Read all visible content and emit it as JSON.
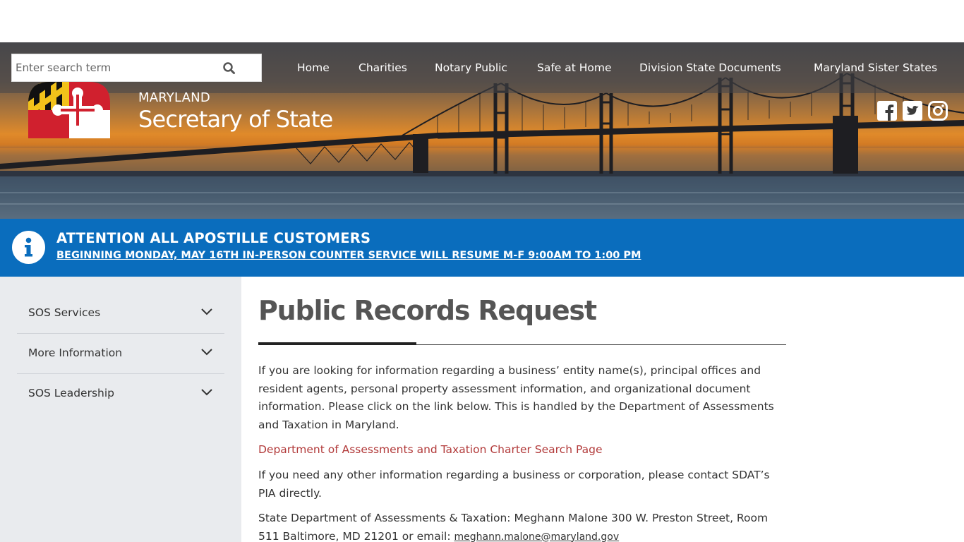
{
  "search": {
    "placeholder": "Enter search term",
    "icon": "search-icon"
  },
  "nav": {
    "items": [
      {
        "label": "Home"
      },
      {
        "label": "Charities"
      },
      {
        "label": "Notary Public"
      },
      {
        "label": "Safe at Home"
      },
      {
        "label": "Division State Documents"
      },
      {
        "label": "Maryland Sister States"
      }
    ]
  },
  "branding": {
    "kicker": "MARYLAND",
    "title": "Secretary of State"
  },
  "social": {
    "icons": [
      "facebook-icon",
      "twitter-icon",
      "instagram-icon"
    ]
  },
  "alert": {
    "title": "ATTENTION ALL APOSTILLE CUSTOMERS",
    "link": "BEGINNING MONDAY, MAY 16TH IN-PERSON COUNTER SERVICE WILL RESUME M-F 9:00AM TO 1:00 PM",
    "icon": "info-icon"
  },
  "sidebar": {
    "items": [
      {
        "label": "SOS Services"
      },
      {
        "label": "More Information"
      },
      {
        "label": "SOS Leadership"
      }
    ]
  },
  "main": {
    "title": "Public Records Request",
    "intro": "If you are looking for information regarding a business’ entity name(s), principal offices and resident agents, personal property assessment information, and organizational document information. Please click on the link below. This is handled by the Department of Assessments and Taxation in Maryland.",
    "dat_link": "Department of Assessments and Taxation Charter Search Page",
    "para2": "If you need any other information regarding a business or corporation, please contact SDAT’s PIA directly.",
    "para3_text": "State Department of Assessments & Taxation: Meghann Malone 300 W. Preston Street, Room 511 Baltimore, MD 21201 or email: ",
    "para3_email": "meghann.malone@maryland.gov"
  },
  "colors": {
    "alert_bg": "#0a6dbd",
    "link_red": "#b23a3a",
    "sidebar_bg": "#e9ebee"
  }
}
